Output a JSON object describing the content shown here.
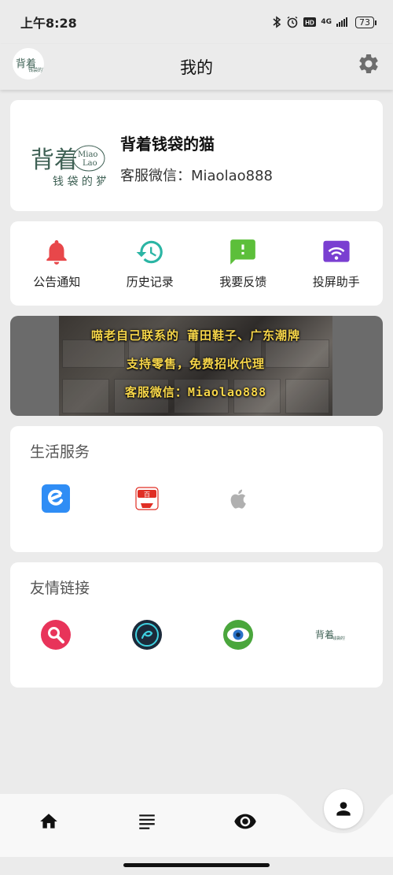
{
  "status_bar": {
    "time": "上午8:28",
    "network": "4G",
    "battery": "73"
  },
  "app_bar": {
    "title": "我的",
    "avatar_icon": "miaolao-logo-icon",
    "settings_icon": "gear-icon"
  },
  "profile": {
    "name": "背着钱袋的猫",
    "wechat": "客服微信：Miaolao888",
    "logo_text": {
      "main": "背着",
      "en_top": "Miao",
      "en_bottom": "Lao",
      "sub": "钱 袋 的 猫"
    }
  },
  "quick_actions": [
    {
      "label": "公告通知",
      "icon": "bell-icon",
      "color": "#e8474a"
    },
    {
      "label": "历史记录",
      "icon": "history-icon",
      "color": "#2bb5a4"
    },
    {
      "label": "我要反馈",
      "icon": "feedback-icon",
      "color": "#5cbf3a"
    },
    {
      "label": "投屏助手",
      "icon": "cast-icon",
      "color": "#7a3fd1"
    }
  ],
  "banner": {
    "line1": "喵老自己联系的 莆田鞋子、广东潮牌",
    "line2": "支持零售，免费招收代理",
    "line3": "客服微信：Miaolao888",
    "text_color": "#f7d64a"
  },
  "life_services": {
    "title": "生活服务",
    "items": [
      {
        "icon": "eleme-icon",
        "color": "#2f8df5"
      },
      {
        "icon": "pinduoduo-icon",
        "color": "#e02e24"
      },
      {
        "icon": "apple-icon",
        "color": "#b0b0b0"
      }
    ]
  },
  "friend_links": {
    "title": "友情链接",
    "items": [
      {
        "icon": "search-app-icon",
        "color": "#e8345a"
      },
      {
        "icon": "music-app-icon",
        "color": "#1c2a3a"
      },
      {
        "icon": "eye-app-icon",
        "color": "#4aa63c"
      },
      {
        "icon": "miaolao-logo-icon",
        "color": "#3f6155"
      }
    ]
  },
  "bottom_nav": [
    {
      "icon": "home-icon"
    },
    {
      "icon": "list-icon"
    },
    {
      "icon": "eye-icon"
    },
    {
      "icon": "person-icon",
      "active": true
    }
  ]
}
